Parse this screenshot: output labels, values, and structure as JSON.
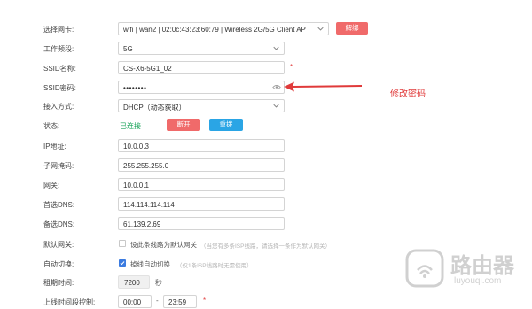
{
  "rows": {
    "nic": {
      "label": "选择网卡:",
      "value": "wifi | wan2 | 02:0c:43:23:60:79 | Wireless 2G/5G Client AP",
      "button": "解绑"
    },
    "band": {
      "label": "工作频段:",
      "value": "5G"
    },
    "ssid": {
      "label": "SSID名称:",
      "value": "CS-X6-5G1_02",
      "star": "*"
    },
    "pwd": {
      "label": "SSID密码:",
      "value": "••••••••"
    },
    "access": {
      "label": "接入方式:",
      "value": "DHCP（动态获取）"
    },
    "status": {
      "label": "状态:",
      "value": "已连接",
      "disconnect": "断开",
      "redial": "重拨"
    },
    "ip": {
      "label": "IP地址:",
      "value": "10.0.0.3"
    },
    "mask": {
      "label": "子网掩码:",
      "value": "255.255.255.0"
    },
    "gw": {
      "label": "网关:",
      "value": "10.0.0.1"
    },
    "dns1": {
      "label": "首选DNS:",
      "value": "114.114.114.114"
    },
    "dns2": {
      "label": "备选DNS:",
      "value": "61.139.2.69"
    },
    "defgw": {
      "label": "默认网关:",
      "check_label": "设此条线路为默认网关",
      "hint": "（当您有多条ISP线路，请选择一条作为默认网关）"
    },
    "auto": {
      "label": "自动切换:",
      "check_label": "掉线自动切换",
      "hint": "（仅1条ISP线路时无需使用）"
    },
    "lease": {
      "label": "租期时间:",
      "value": "7200",
      "unit": "秒"
    },
    "online": {
      "label": "上线时间段控制:",
      "start": "00:00",
      "sep": "-",
      "end": "23:59",
      "star": "*"
    }
  },
  "annotation": {
    "text": "修改密码",
    "color": "#e03a3a"
  },
  "watermark": {
    "title": "路由器",
    "sub": "luyouqi.com"
  },
  "colors": {
    "accent_red": "#f06a6a",
    "accent_blue": "#2aa5e5",
    "connected_green": "#1aa35a"
  }
}
